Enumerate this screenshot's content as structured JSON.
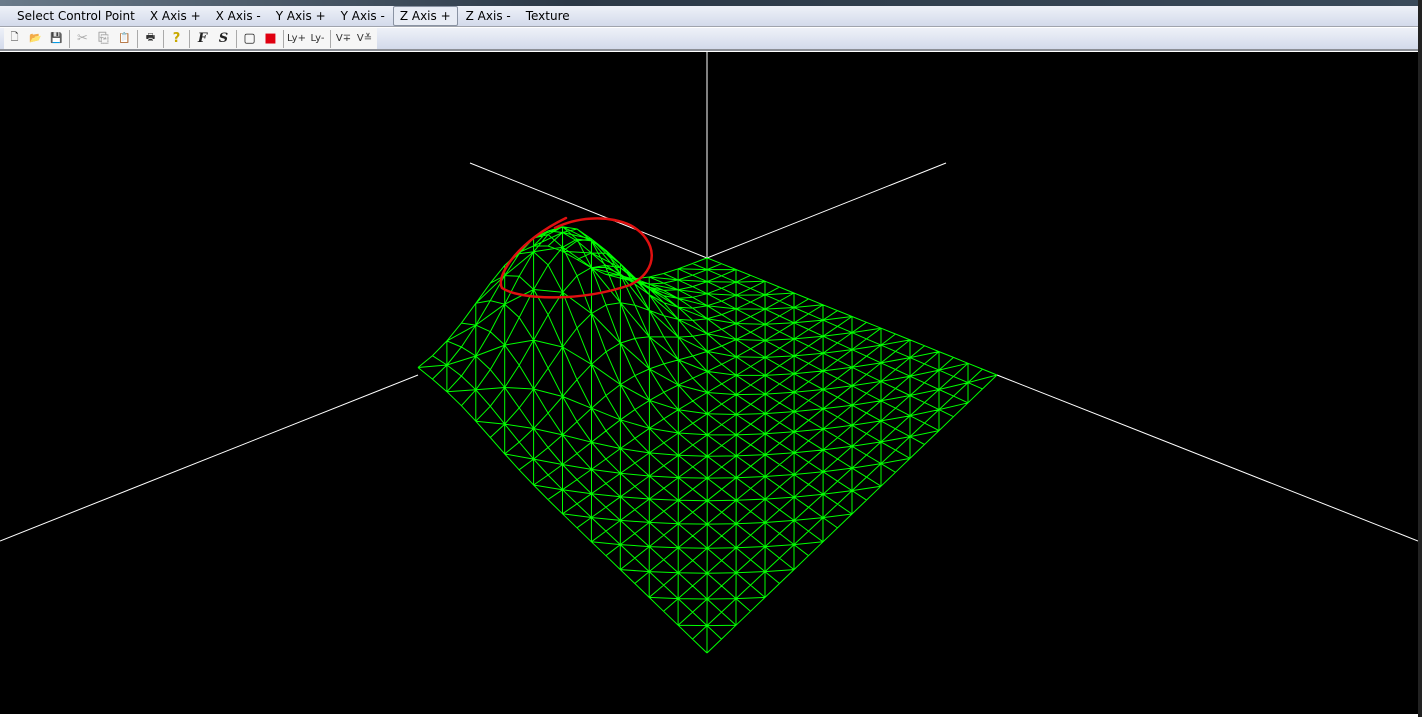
{
  "menu": [
    "Select Control Point",
    "X Axis +",
    "X Axis -",
    "Y Axis +",
    "Y Axis -",
    "Z Axis +",
    "Z Axis -",
    "Texture"
  ],
  "active_menu": "Z Axis +",
  "toolbar": [
    {
      "name": "new-icon",
      "glyph": "🗋"
    },
    {
      "name": "open-icon",
      "glyph": "📂"
    },
    {
      "name": "save-icon",
      "glyph": "💾"
    },
    "sep",
    {
      "name": "cut-icon",
      "glyph": "✂"
    },
    {
      "name": "copy-icon",
      "glyph": "⎘"
    },
    {
      "name": "paste-icon",
      "glyph": "📋"
    },
    "sep",
    {
      "name": "print-icon",
      "glyph": "🖶"
    },
    "sep",
    {
      "name": "help-icon",
      "glyph": "?"
    },
    "sep",
    {
      "name": "font-f-icon",
      "glyph": "F"
    },
    {
      "name": "font-s-icon",
      "glyph": "S"
    },
    "sep",
    {
      "name": "wireframe-cube-icon",
      "glyph": "▢"
    },
    {
      "name": "color-cube-icon",
      "glyph": "■"
    },
    "sep",
    {
      "name": "ly-plus-icon",
      "glyph": "Ly+"
    },
    {
      "name": "ly-minus-icon",
      "glyph": "Ly-"
    },
    "sep",
    {
      "name": "v-plus-icon",
      "glyph": "V∓"
    },
    {
      "name": "v-z-icon",
      "glyph": "V≚"
    }
  ],
  "colors": {
    "mesh": "#00ff00",
    "axes": "#ffffff",
    "annotation": "#e01010",
    "background": "#000000"
  }
}
